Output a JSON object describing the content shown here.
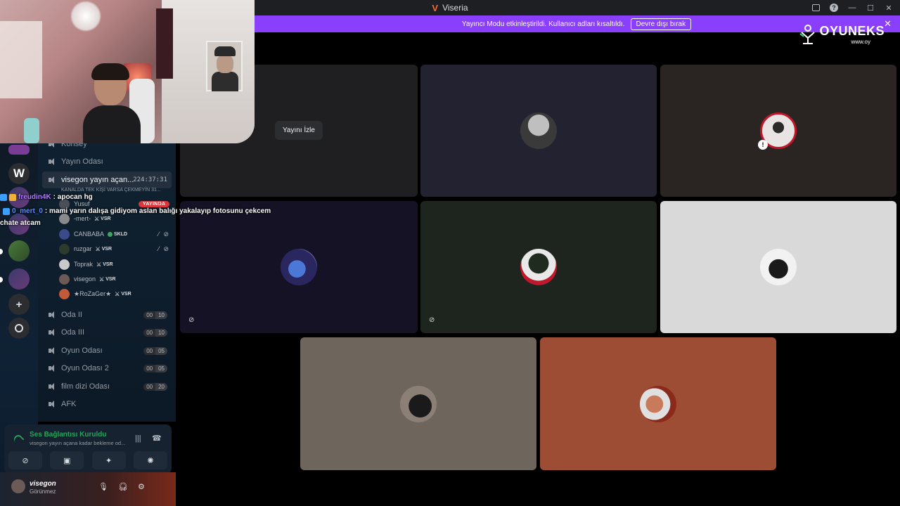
{
  "window": {
    "app_name": "Viseria",
    "logo_glyph": "V"
  },
  "banner": {
    "message": "Yayıncı Modu etkinleştirildi. Kullanıcı adları kısaltıldı.",
    "button_label": "Devre dışı bırak"
  },
  "brand": {
    "name": "OYUNEKS",
    "url": "www.oy"
  },
  "channels": [
    {
      "name": "Konsey"
    },
    {
      "name": "Yayın Odası"
    },
    {
      "name": "visegon yayın açan...",
      "timer": "224:37:31",
      "subtitle": "KANALDA TEK KİŞİ VARSA ÇEKMEYİN 31..."
    }
  ],
  "members": [
    {
      "name": "Yusuf"
    },
    {
      "name": "-mert-",
      "tag": "VSR"
    },
    {
      "name": "CANBABA",
      "tag": "SKLD"
    },
    {
      "name": "ruzgar",
      "tag": "VSR"
    },
    {
      "name": "Toprak",
      "tag": "VSR"
    },
    {
      "name": "visegon",
      "tag": "VSR"
    },
    {
      "name": "★RoZaGer★",
      "tag": "VSR"
    }
  ],
  "live_badge": "YAYINDA",
  "rooms": [
    {
      "name": "Oda II",
      "count": "00",
      "limit": "10"
    },
    {
      "name": "Oda III",
      "count": "00",
      "limit": "10"
    },
    {
      "name": "Oyun Odası",
      "count": "00",
      "limit": "05"
    },
    {
      "name": "Oyun Odası 2",
      "count": "00",
      "limit": "05"
    },
    {
      "name": "film dizi Odası",
      "count": "00",
      "limit": "20"
    },
    {
      "name": "AFK"
    }
  ],
  "chat": [
    {
      "user": "freudin4K",
      "message": ": apocan hg"
    },
    {
      "user": "0_mert_0",
      "message": ": mami yarın dalışa gidiyom aslan balığı yakalayıp fotosunu çekcem"
    },
    {
      "user": "",
      "message": "chate atcam"
    }
  ],
  "voice": {
    "status": "Ses Bağlantısı Kuruldu",
    "channel": "visegon yayın açana kadar bekleme od..."
  },
  "user": {
    "name": "visegon",
    "status": "Görünmez"
  },
  "stage": {
    "watch_label": "Yayını İzle"
  },
  "colors": {
    "banner": "#8a3ffc",
    "connected": "#23a55a",
    "live": "#da373c"
  }
}
